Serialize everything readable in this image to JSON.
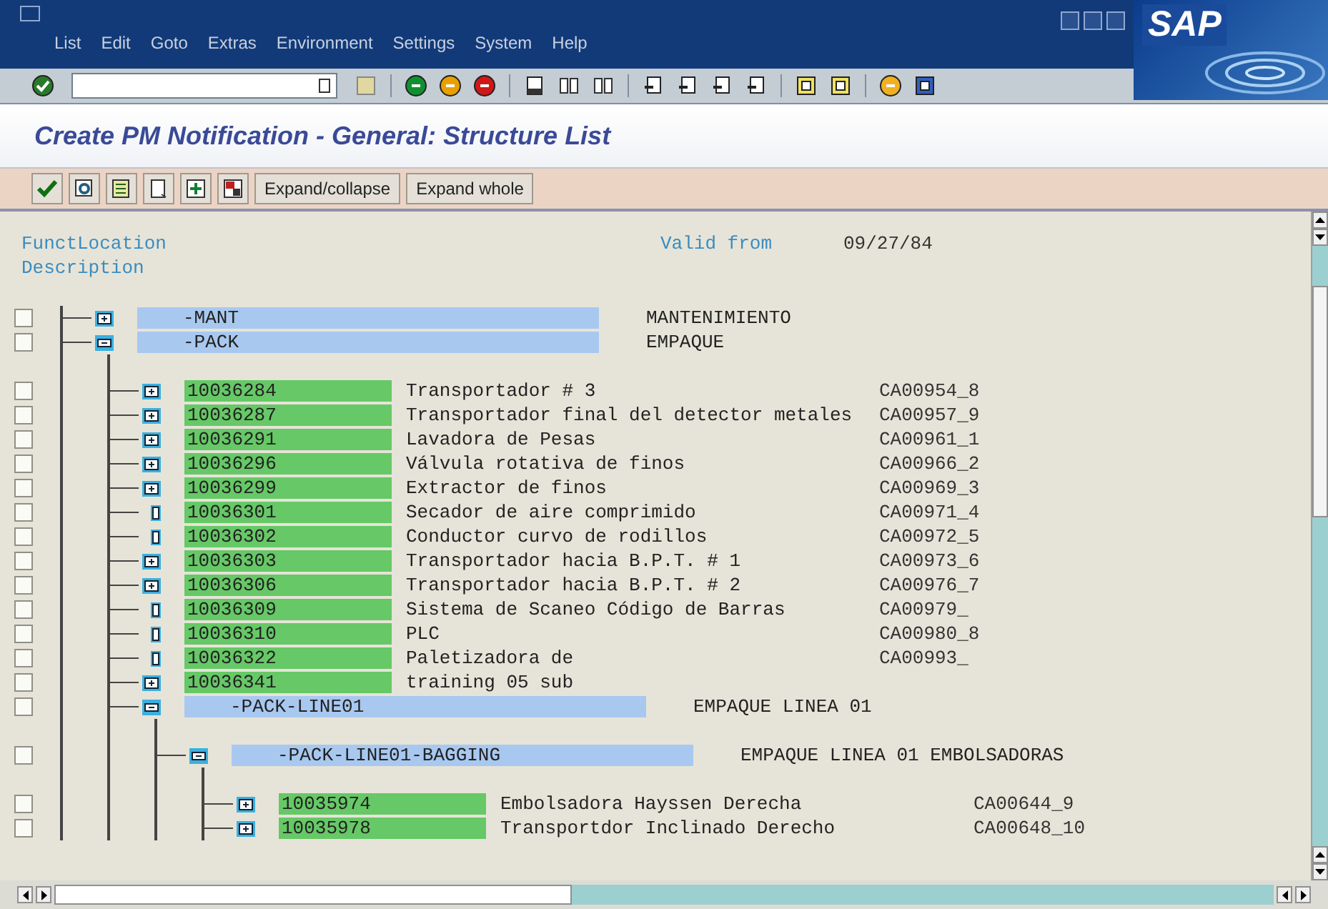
{
  "window": {
    "logo": "SAP",
    "menu": [
      "List",
      "Edit",
      "Goto",
      "Extras",
      "Environment",
      "Settings",
      "System",
      "Help"
    ]
  },
  "title": "Create PM Notification - General: Structure List",
  "app_toolbar": {
    "buttons": [
      "Expand/collapse",
      "Expand whole"
    ]
  },
  "header": {
    "location_label": "FunctLocation",
    "description_label": "Description",
    "valid_from_label": "Valid from",
    "valid_from": "09/27/84"
  },
  "tree": [
    {
      "label": "-MANT",
      "kind": "location",
      "leaf": false,
      "expanded": false,
      "description": "MANTENIMIENTO",
      "checked": false
    },
    {
      "label": "-PACK",
      "kind": "location",
      "leaf": false,
      "expanded": true,
      "description": "EMPAQUE",
      "checked": false,
      "children": [
        {
          "label": "10036284",
          "kind": "equipment",
          "leaf": false,
          "expanded": false,
          "description": "Transportador # 3",
          "code": "CA00954_8",
          "checked": false
        },
        {
          "label": "10036287",
          "kind": "equipment",
          "leaf": false,
          "expanded": false,
          "description": "Transportador final del detector metales",
          "code": "CA00957_9",
          "checked": false
        },
        {
          "label": "10036291",
          "kind": "equipment",
          "leaf": false,
          "expanded": false,
          "description": "Lavadora de Pesas",
          "code": "CA00961_1",
          "checked": false
        },
        {
          "label": "10036296",
          "kind": "equipment",
          "leaf": false,
          "expanded": false,
          "description": "Válvula rotativa de finos",
          "code": "CA00966_2",
          "checked": false
        },
        {
          "label": "10036299",
          "kind": "equipment",
          "leaf": false,
          "expanded": false,
          "description": "Extractor de finos",
          "code": "CA00969_3",
          "checked": false
        },
        {
          "label": "10036301",
          "kind": "equipment",
          "leaf": true,
          "expanded": false,
          "description": "Secador de aire comprimido",
          "code": "CA00971_4",
          "checked": false
        },
        {
          "label": "10036302",
          "kind": "equipment",
          "leaf": true,
          "expanded": false,
          "description": "Conductor curvo de rodillos",
          "code": "CA00972_5",
          "checked": false
        },
        {
          "label": "10036303",
          "kind": "equipment",
          "leaf": false,
          "expanded": false,
          "description": "Transportador hacia B.P.T. # 1",
          "code": "CA00973_6",
          "checked": false
        },
        {
          "label": "10036306",
          "kind": "equipment",
          "leaf": false,
          "expanded": false,
          "description": "Transportador hacia B.P.T. # 2",
          "code": "CA00976_7",
          "checked": false
        },
        {
          "label": "10036309",
          "kind": "equipment",
          "leaf": true,
          "expanded": false,
          "description": "Sistema de Scaneo Código de Barras",
          "code": "CA00979_",
          "checked": false
        },
        {
          "label": "10036310",
          "kind": "equipment",
          "leaf": true,
          "expanded": false,
          "description": "PLC",
          "code": "CA00980_8",
          "checked": false
        },
        {
          "label": "10036322",
          "kind": "equipment",
          "leaf": true,
          "expanded": false,
          "description": "Paletizadora de",
          "code": "CA00993_",
          "checked": false
        },
        {
          "label": "10036341",
          "kind": "equipment",
          "leaf": false,
          "expanded": false,
          "description": "training 05 sub",
          "checked": false
        },
        {
          "label": "-PACK-LINE01",
          "kind": "location",
          "leaf": false,
          "expanded": true,
          "description": "EMPAQUE LINEA 01",
          "checked": false,
          "children": [
            {
              "label": "-PACK-LINE01-BAGGING",
              "kind": "location",
              "leaf": false,
              "expanded": true,
              "description": "EMPAQUE LINEA 01 EMBOLSADORAS",
              "checked": false,
              "children": [
                {
                  "label": "10035974",
                  "kind": "equipment",
                  "leaf": false,
                  "expanded": false,
                  "description": "Embolsadora Hayssen Derecha",
                  "code": "CA00644_9",
                  "checked": false
                },
                {
                  "label": "10035978",
                  "kind": "equipment",
                  "leaf": false,
                  "expanded": false,
                  "description": "Transportdor Inclinado Derecho",
                  "code": "CA00648_10",
                  "checked": false
                }
              ]
            }
          ]
        }
      ]
    }
  ]
}
